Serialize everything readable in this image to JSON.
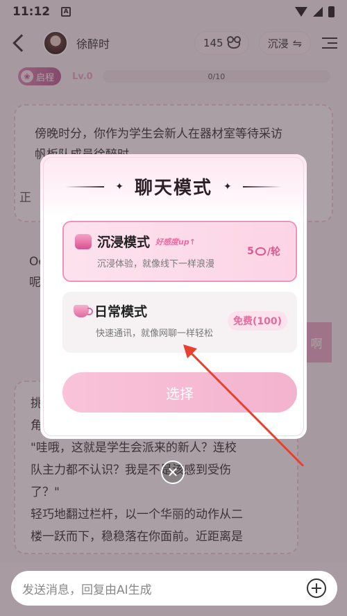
{
  "status_bar": {
    "time": "11:12",
    "notif": "A"
  },
  "header": {
    "user_name": "徐醉时",
    "coins": "145",
    "mode_label": "沉浸",
    "swap_glyph": "⇋"
  },
  "level": {
    "badge": "启程",
    "badge_icon": "❀",
    "level": "Lv.0",
    "progress_text": "0/10",
    "progress_fraction": 0
  },
  "background": {
    "story_line1": "傍晚时分，你作为学生会新人在器材室等待采访",
    "story_line2": "帆板队成员徐醉时",
    "story_cut": "正",
    "chat_a_line1": "Oc",
    "chat_a_line2": "呢",
    "right_btn": "啊",
    "story2_line1": "挑",
    "story2_line2": "角",
    "story2_line3": "\"哇哦，这就是学生会派来的新人？连校",
    "story2_line4": "队主力都不认识？我是不是该感到受伤",
    "story2_line5": "了？\"",
    "story2_line6": "轻巧地翻过栏杆，以一个华丽的动作从二",
    "story2_line7": "楼一跃而下，稳稳落在你面前。近距离是"
  },
  "modal": {
    "title": "聊天模式",
    "star": "✦",
    "options": [
      {
        "name": "沉浸模式",
        "tag": "好感度up↑",
        "desc": "沉浸体验，就像线下一样浪漫",
        "price_num": "5",
        "price_unit": "/轮"
      },
      {
        "name": "日常模式",
        "desc": "快速通讯，就像网聊一样轻松",
        "price": "免费(100)"
      }
    ],
    "select_label": "选择",
    "close_glyph": "✕"
  },
  "input": {
    "placeholder": "发送消息，回复由AI生成"
  },
  "colors": {
    "accent": "#f28fbb",
    "price": "#e3528f",
    "arrow": "#e8402f"
  }
}
